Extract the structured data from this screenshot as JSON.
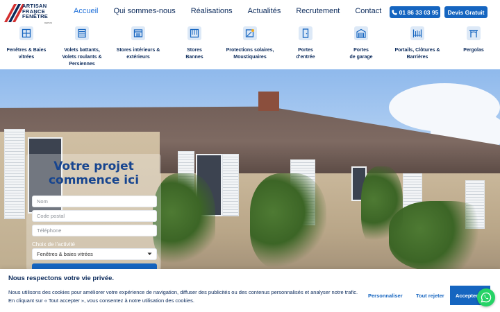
{
  "brand": {
    "logo_lines": [
      "ARTISAN",
      "FRANCE",
      "FENÊTRE"
    ],
    "logo_sub": "DEPUIS 2001"
  },
  "nav": {
    "items": [
      "Accueil",
      "Qui sommes-nous",
      "Réalisations",
      "Actualités",
      "Recrutement",
      "Contact"
    ],
    "active": "Accueil"
  },
  "header_buttons": {
    "phone": "01 86 33 03 95",
    "devis": "Devis Gratuit"
  },
  "categories": [
    {
      "lines": [
        "Fenêtres & Baies",
        "vitrées"
      ],
      "icon": "window-icon"
    },
    {
      "lines": [
        "Volets battants,",
        "Volets roulants &",
        "Persiennes"
      ],
      "icon": "shutter-icon"
    },
    {
      "lines": [
        "Stores intérieurs &",
        "extérieurs"
      ],
      "icon": "store-icon"
    },
    {
      "lines": [
        "Stores",
        "Bannes"
      ],
      "icon": "awning-icon"
    },
    {
      "lines": [
        "Protections solaires,",
        "Moustiquaires"
      ],
      "icon": "sun-protection-icon"
    },
    {
      "lines": [
        "Portes",
        "d'entrée"
      ],
      "icon": "door-icon"
    },
    {
      "lines": [
        "Portes",
        "de garage"
      ],
      "icon": "garage-icon"
    },
    {
      "lines": [
        "Portails, Clôtures &",
        "Barrières"
      ],
      "icon": "gate-icon"
    },
    {
      "lines": [
        "Pergolas"
      ],
      "icon": "pergola-icon"
    }
  ],
  "form": {
    "title_line1": "Votre projet",
    "title_line2": "commence ici",
    "name_placeholder": "Nom",
    "postal_placeholder": "Code postal",
    "phone_placeholder": "Téléphone",
    "activity_label": "Choix de l'activité",
    "activity_value": "Fenêtres & baies vitrées"
  },
  "cookie": {
    "title": "Nous respectons votre vie privée.",
    "line1": "Nous utilisons des cookies pour améliorer votre expérience de navigation, diffuser des publicités ou des contenus personnalisés et analyser notre trafic.",
    "line2": "En cliquant sur « Tout accepter », vous consentez à notre utilisation des cookies.",
    "customize": "Personnaliser",
    "reject": "Tout rejeter",
    "accept": "Accepter"
  },
  "colors": {
    "brand_blue": "#1565c0",
    "navy": "#0b2a5b",
    "whatsapp": "#25d366"
  }
}
